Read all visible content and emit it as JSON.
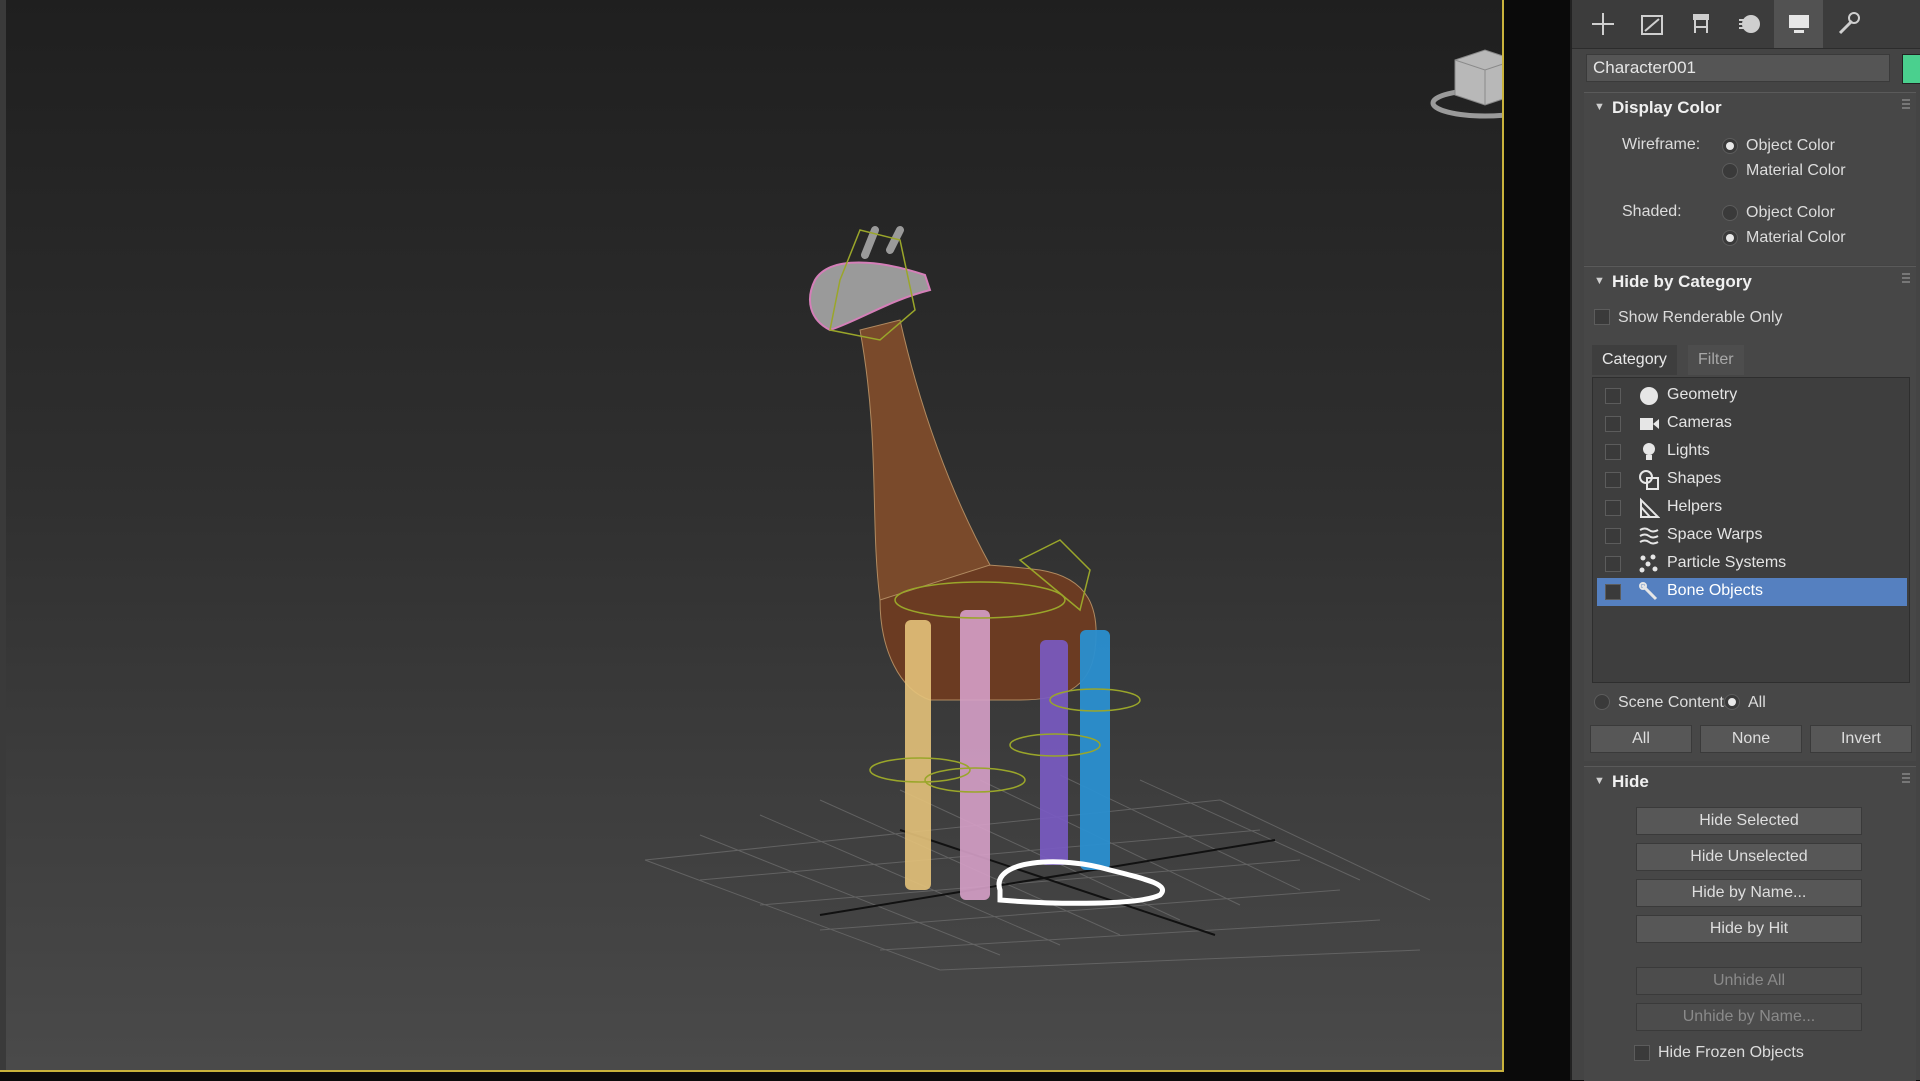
{
  "colors": {
    "viewport_border": "#c9b33c",
    "selection": "#5580c0",
    "object_color_swatch": "#4ad08e"
  },
  "command_panel": {
    "tabs": [
      {
        "icon": "create-icon",
        "active": false
      },
      {
        "icon": "modify-icon",
        "active": false
      },
      {
        "icon": "hierarchy-icon",
        "active": false
      },
      {
        "icon": "motion-icon",
        "active": false
      },
      {
        "icon": "display-icon",
        "active": true
      },
      {
        "icon": "utilities-icon",
        "active": false
      }
    ],
    "object_name": "Character001",
    "display_color": {
      "title": "Display Color",
      "wireframe_label": "Wireframe:",
      "shaded_label": "Shaded:",
      "object_color": "Object Color",
      "material_color": "Material Color",
      "wireframe_selected": "Object Color",
      "shaded_selected": "Material Color"
    },
    "hide_by_category": {
      "title": "Hide by Category",
      "show_renderable_only": "Show Renderable Only",
      "tab_category": "Category",
      "tab_filter": "Filter",
      "categories": [
        {
          "label": "Geometry",
          "icon": "geometry-icon",
          "checked": false,
          "selected": false
        },
        {
          "label": "Cameras",
          "icon": "camera-icon",
          "checked": false,
          "selected": false
        },
        {
          "label": "Lights",
          "icon": "light-bulb-icon",
          "checked": false,
          "selected": false
        },
        {
          "label": "Shapes",
          "icon": "shapes-icon",
          "checked": false,
          "selected": false
        },
        {
          "label": "Helpers",
          "icon": "helpers-icon",
          "checked": false,
          "selected": false
        },
        {
          "label": "Space Warps",
          "icon": "space-warps-icon",
          "checked": false,
          "selected": false
        },
        {
          "label": "Particle Systems",
          "icon": "particle-systems-icon",
          "checked": false,
          "selected": false
        },
        {
          "label": "Bone Objects",
          "icon": "bone-objects-icon",
          "checked": false,
          "selected": true
        }
      ],
      "scene_contents": "Scene Contents",
      "all_radio": "All",
      "btn_all": "All",
      "btn_none": "None",
      "btn_invert": "Invert"
    },
    "hide": {
      "title": "Hide",
      "hide_selected": "Hide Selected",
      "hide_unselected": "Hide Unselected",
      "hide_by_name": "Hide by Name...",
      "hide_by_hit": "Hide by Hit",
      "unhide_all": "Unhide All",
      "unhide_by_name": "Unhide by Name...",
      "hide_frozen_objects": "Hide Frozen Objects"
    }
  }
}
